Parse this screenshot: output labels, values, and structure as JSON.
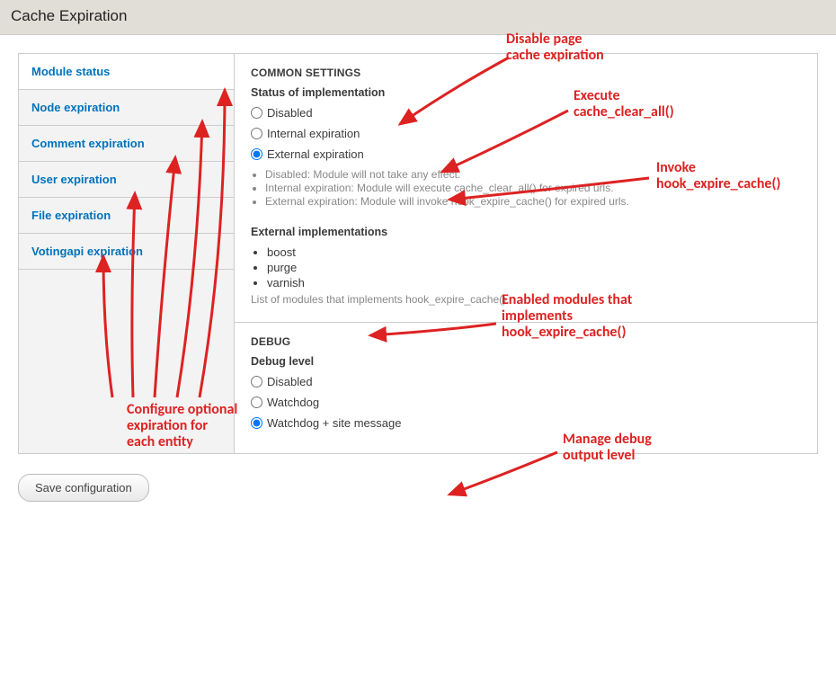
{
  "page_title": "Cache Expiration",
  "sidebar": {
    "items": [
      {
        "label": "Module status",
        "selected": true
      },
      {
        "label": "Node expiration"
      },
      {
        "label": "Comment expiration"
      },
      {
        "label": "User expiration"
      },
      {
        "label": "File expiration"
      },
      {
        "label": "Votingapi expiration"
      }
    ]
  },
  "common": {
    "legend": "COMMON SETTINGS",
    "status_heading": "Status of implementation",
    "options": [
      {
        "label": "Disabled",
        "checked": false
      },
      {
        "label": "Internal expiration",
        "checked": false
      },
      {
        "label": "External expiration",
        "checked": true
      }
    ],
    "descriptions": [
      "Disabled: Module will not take any effect.",
      "Internal expiration: Module will execute cache_clear_all() for expired urls.",
      "External expiration: Module will invoke hook_expire_cache() for expired urls."
    ],
    "ext_heading": "External implementations",
    "ext_items": [
      "boost",
      "purge",
      "varnish"
    ],
    "ext_desc": "List of modules that implements hook_expire_cache()."
  },
  "debug": {
    "legend": "DEBUG",
    "heading": "Debug level",
    "options": [
      {
        "label": "Disabled",
        "checked": false
      },
      {
        "label": "Watchdog",
        "checked": false
      },
      {
        "label": "Watchdog + site message",
        "checked": true
      }
    ]
  },
  "save_label": "Save configuration",
  "annotations": {
    "a1": "Disable page\ncache expiration",
    "a2": "Execute\ncache_clear_all()",
    "a3": "Invoke\nhook_expire_cache()",
    "a4": "Enabled modules that\nimplements\nhook_expire_cache()",
    "a5": "Manage debug\noutput level",
    "a6": "Configure optional\nexpiration for\neach entity"
  }
}
